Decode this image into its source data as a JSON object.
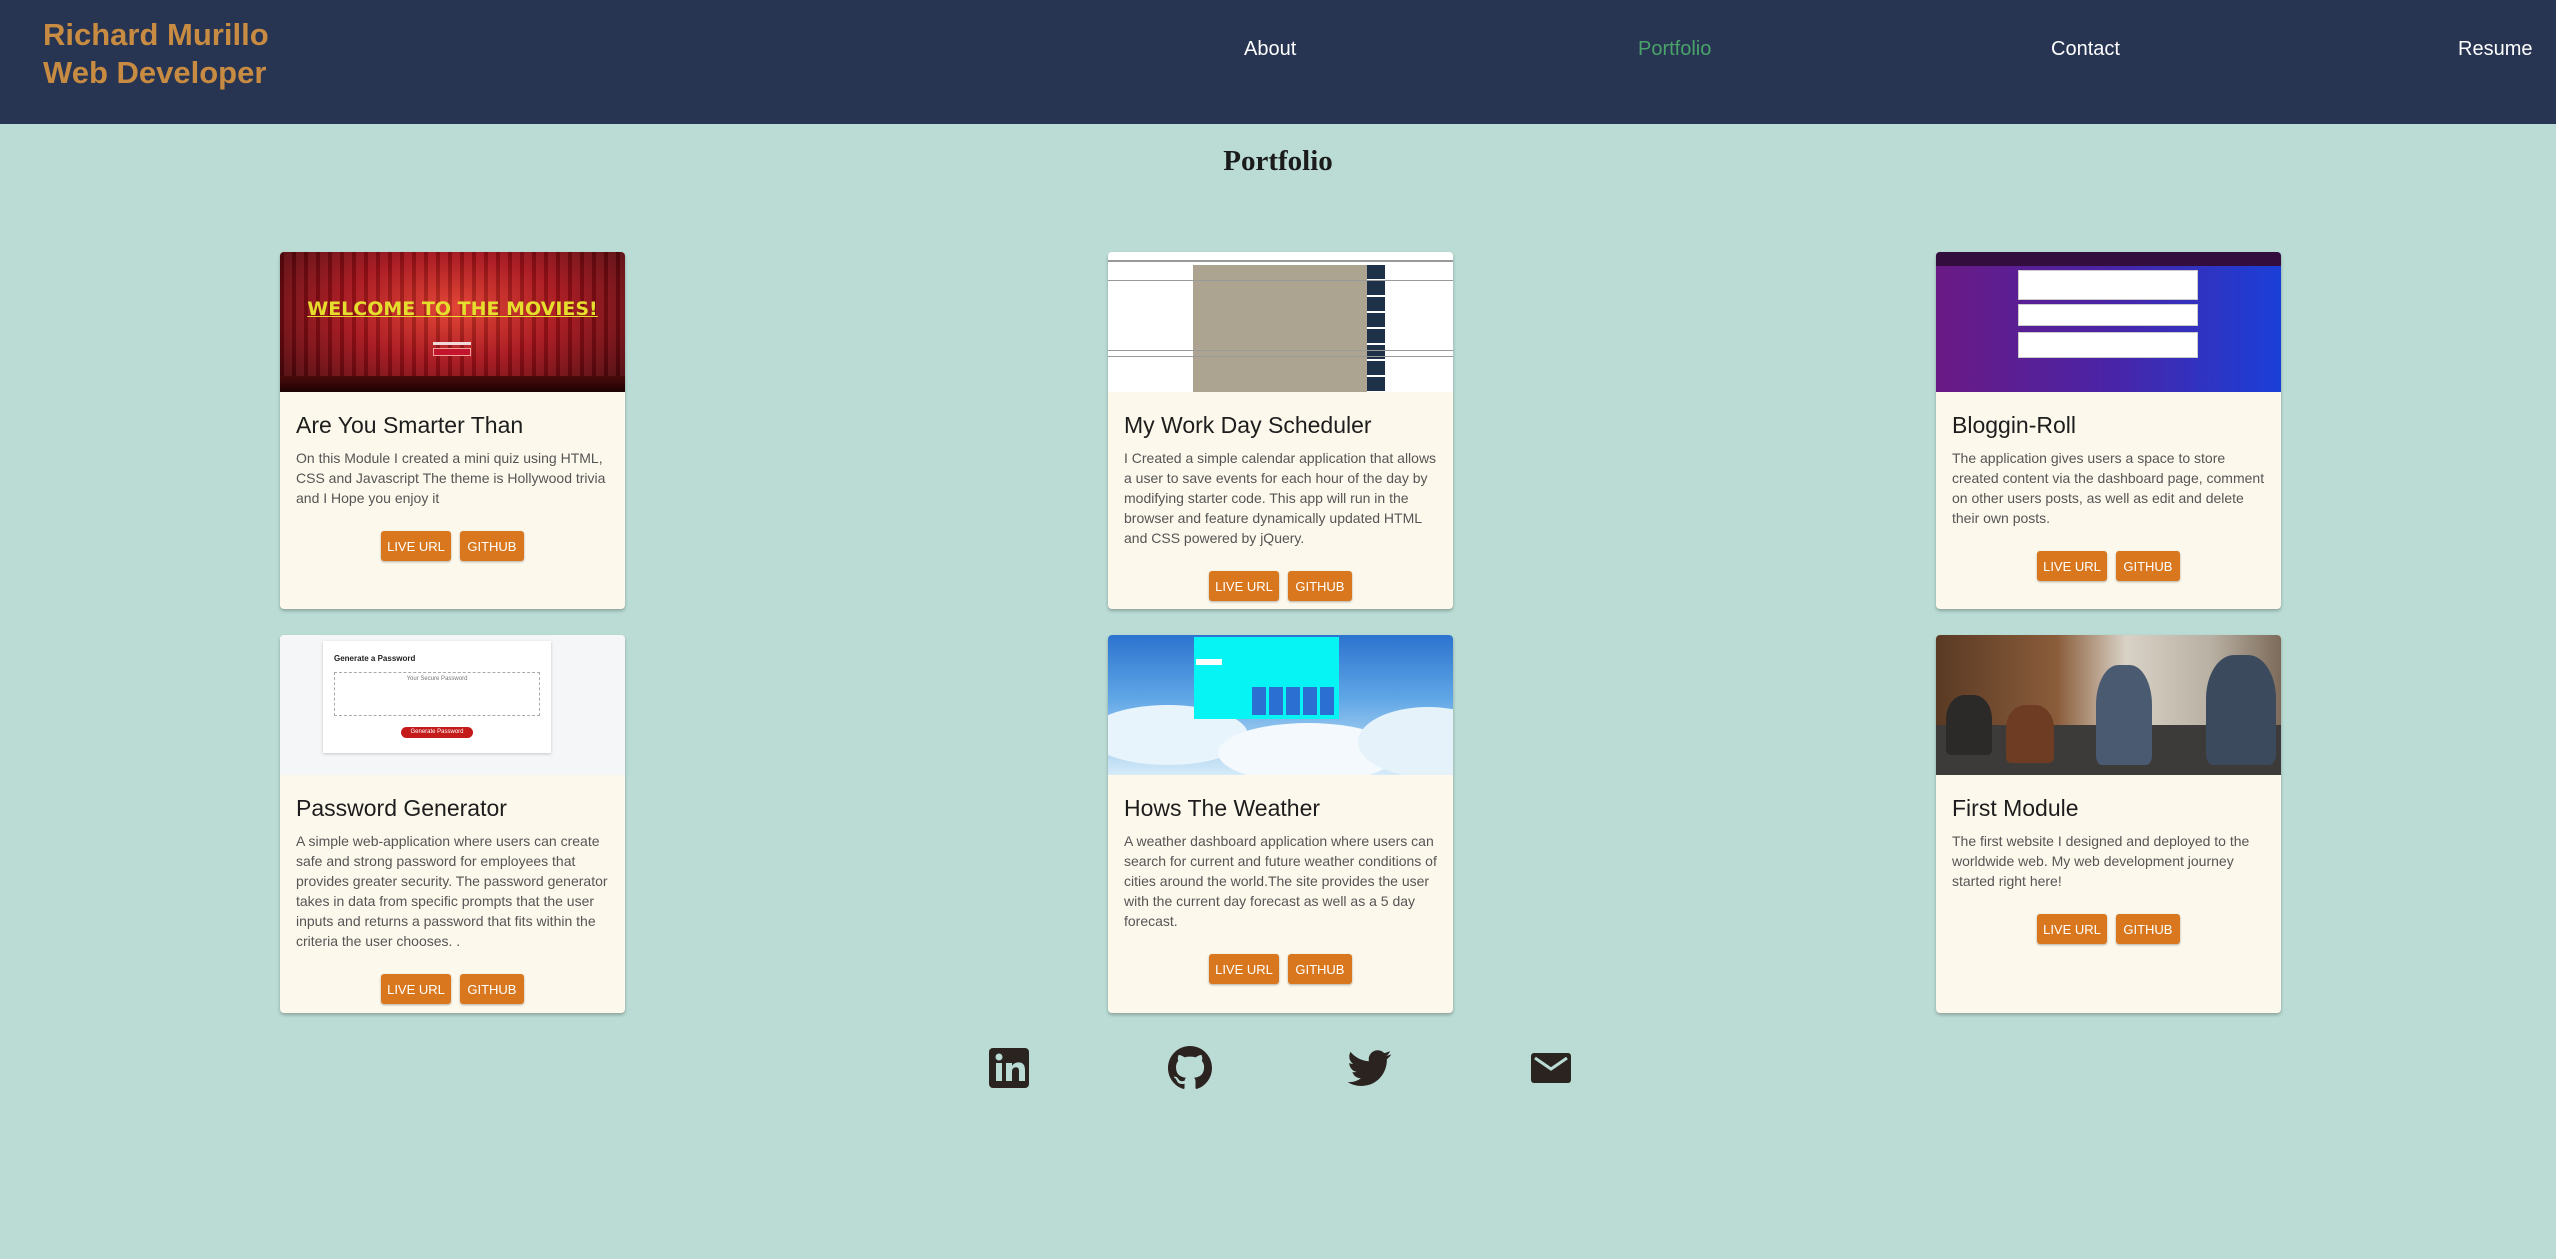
{
  "brand": {
    "line1": "Richard Murillo",
    "line2": "Web Developer",
    "color": "#c88b42"
  },
  "nav": [
    {
      "label": "About"
    },
    {
      "label": "Portfolio",
      "active": true
    },
    {
      "label": "Contact"
    },
    {
      "label": "Resume"
    }
  ],
  "page_title": "Portfolio",
  "thumbs": {
    "movies_text": "WELCOME TO THE MOVIES!",
    "password_heading": "Generate a Password",
    "password_placeholder": "Your Secure Password",
    "password_button": "Generate Password"
  },
  "projects": [
    {
      "title": "Are You Smarter Than",
      "description": "On this Module I created a mini quiz using HTML, CSS and Javascript The theme is Hollywood trivia and I Hope you enjoy it",
      "live_label": "LIVE URL",
      "github_label": "GITHUB"
    },
    {
      "title": "My Work Day Scheduler",
      "description": "I Created a simple calendar application that allows a user to save events for each hour of the day by modifying starter code. This app will run in the browser and feature dynamically updated HTML and CSS powered by jQuery.",
      "live_label": "LIVE URL",
      "github_label": "GITHUB"
    },
    {
      "title": "Bloggin-Roll",
      "description": "The application gives users a space to store created content via the dashboard page, comment on other users posts, as well as edit and delete their own posts.",
      "live_label": "LIVE URL",
      "github_label": "GITHUB"
    },
    {
      "title": "Password Generator",
      "description": "A simple web-application where users can create safe and strong password for employees that provides greater security. The password generator takes in data from specific prompts that the user inputs and returns a password that fits within the criteria the user chooses. .",
      "live_label": "LIVE URL",
      "github_label": "GITHUB"
    },
    {
      "title": "Hows The Weather",
      "description": "A weather dashboard application where users can search for current and future weather conditions of cities around the world.The site provides the user with the current day forecast as well as a 5 day forecast.",
      "live_label": "LIVE URL",
      "github_label": "GITHUB"
    },
    {
      "title": "First Module",
      "description": "The first website I designed and deployed to the worldwide web. My web development journey started right here!",
      "live_label": "LIVE URL",
      "github_label": "GITHUB"
    }
  ],
  "social": [
    {
      "icon": "linkedin-icon"
    },
    {
      "icon": "github-icon"
    },
    {
      "icon": "twitter-icon"
    },
    {
      "icon": "email-icon"
    }
  ],
  "colors": {
    "header_bg": "#273452",
    "page_bg": "#badcd4",
    "card_bg": "#fdf8ec",
    "button": "#d8771e",
    "nav_active": "#4aa36a"
  }
}
